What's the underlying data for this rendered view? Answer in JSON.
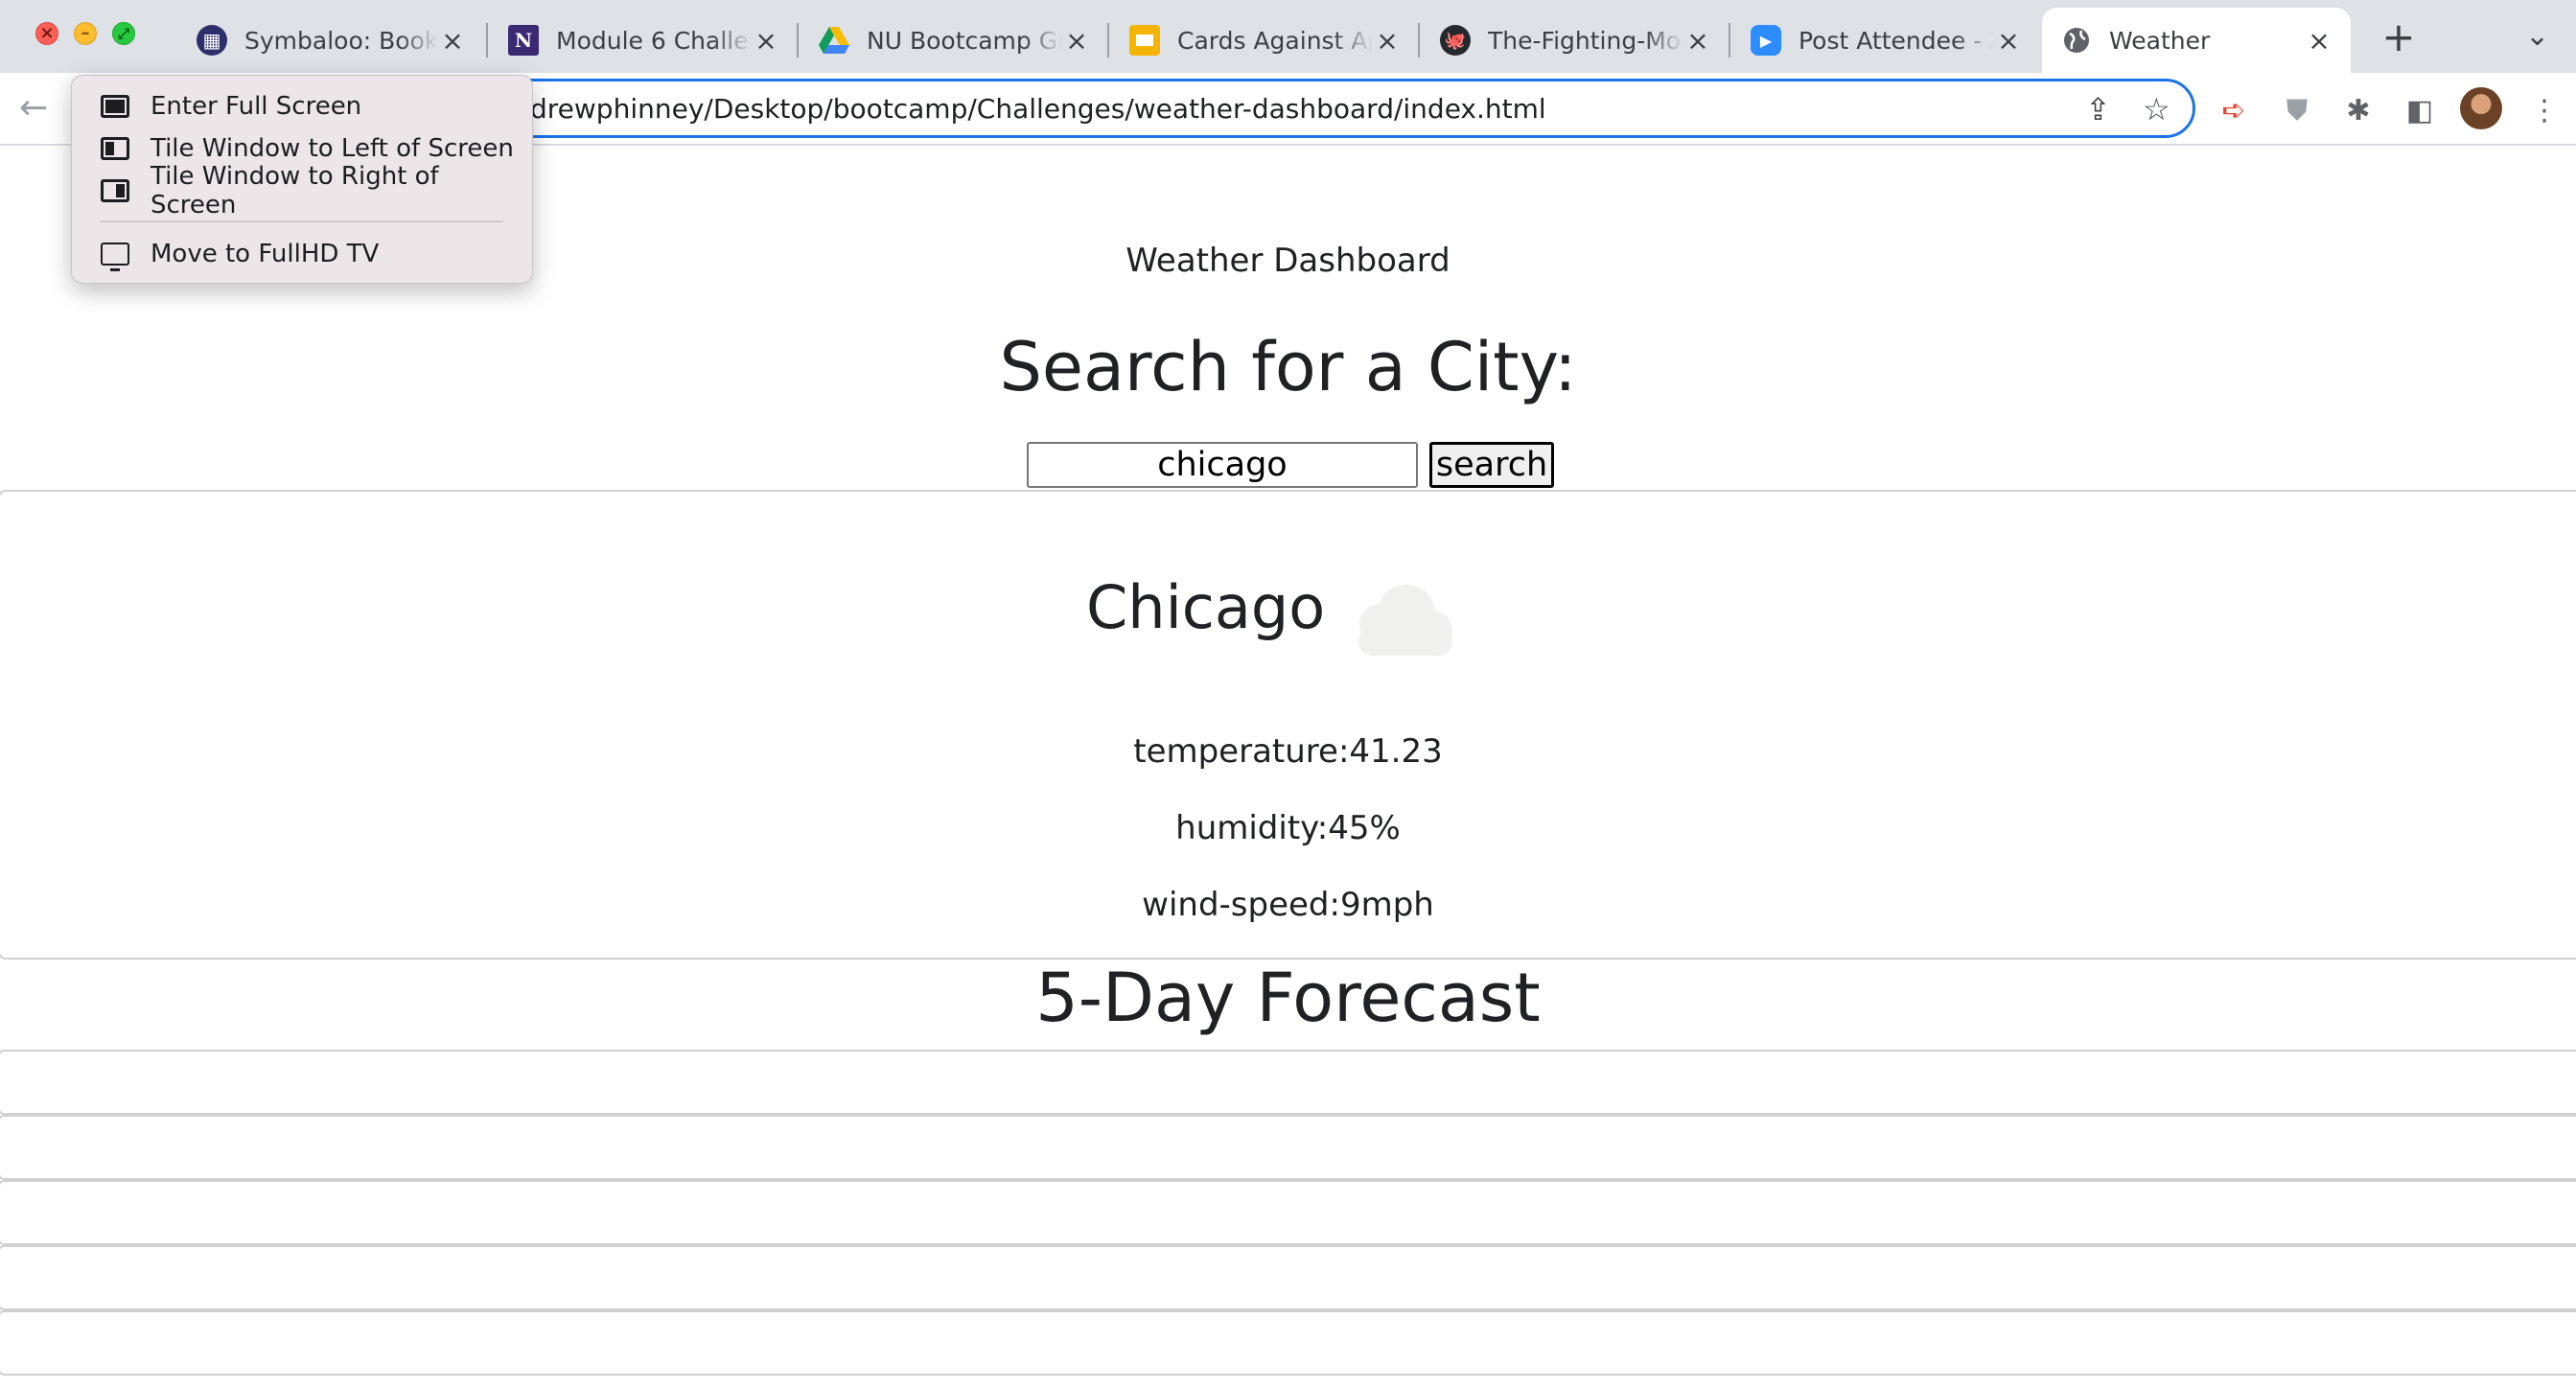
{
  "browser": {
    "tabs": [
      {
        "title": "Symbaloo: Bookmarks",
        "icon": "symbaloo-icon",
        "active": false
      },
      {
        "title": "Module 6 Challenge",
        "icon": "notion-n-icon",
        "active": false
      },
      {
        "title": "NU Bootcamp Group",
        "icon": "google-drive-icon",
        "active": false
      },
      {
        "title": "Cards Against Apes",
        "icon": "google-slides-icon",
        "active": false
      },
      {
        "title": "The-Fighting-Mongooses",
        "icon": "github-icon",
        "active": false
      },
      {
        "title": "Post Attendee - Zoom",
        "icon": "zoom-icon",
        "active": false
      },
      {
        "title": "Weather",
        "icon": "globe-icon",
        "active": true
      }
    ],
    "url": "drewphinney/Desktop/bootcamp/Challenges/weather-dashboard/index.html"
  },
  "context_menu": {
    "items": [
      {
        "label": "Enter Full Screen",
        "icon": "fullscreen-icon"
      },
      {
        "label": "Tile Window to Left of Screen",
        "icon": "tile-left-icon"
      },
      {
        "label": "Tile Window to Right of Screen",
        "icon": "tile-right-icon"
      },
      {
        "label": "Move to FullHD TV",
        "icon": "tv-icon"
      }
    ]
  },
  "page": {
    "header_title": "Weather Dashboard",
    "search_heading": "Search for a City:",
    "search_input_value": "chicago",
    "search_button_label": "search",
    "current": {
      "city": "Chicago",
      "weather_icon": "cloud-icon",
      "temperature": "temperature:41.23",
      "humidity": "humidity:45%",
      "wind_speed": "wind-speed:9mph"
    },
    "forecast_heading": "5-Day Forecast",
    "forecast_days": [
      "",
      "",
      "",
      "",
      ""
    ]
  },
  "colors": {
    "omnibox_focus": "#1a73e8",
    "tabstrip_bg": "#dee1e6",
    "menu_bg": "#ece6e8",
    "cloud": "#f0f0ef"
  }
}
